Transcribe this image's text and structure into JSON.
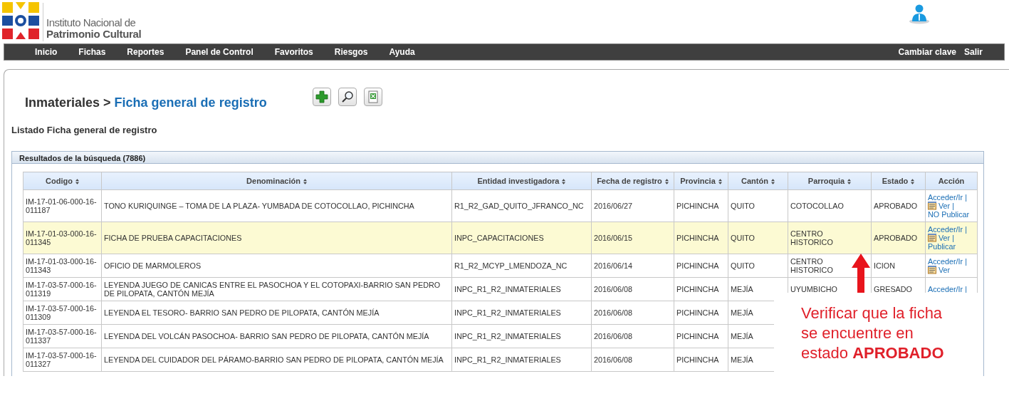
{
  "logo": {
    "line1": "Instituto Nacional de",
    "line2": "Patrimonio Cultural"
  },
  "nav": {
    "items": [
      "Inicio",
      "Fichas",
      "Reportes",
      "Panel de Control",
      "Favoritos",
      "Riesgos",
      "Ayuda"
    ],
    "right": [
      "Cambiar clave",
      "Salir"
    ]
  },
  "breadcrumb": {
    "parent": "Inmateriales",
    "separator": ">",
    "current": "Ficha general de registro"
  },
  "subtitle": "Listado Ficha general de registro",
  "results": {
    "title": "Resultados de la búsqueda (7886)",
    "columns": [
      {
        "label": "Codigo",
        "sortable": true
      },
      {
        "label": "Denominación",
        "sortable": true
      },
      {
        "label": "Entidad investigadora",
        "sortable": true
      },
      {
        "label": "Fecha de registro",
        "sortable": true
      },
      {
        "label": "Provincia",
        "sortable": true
      },
      {
        "label": "Cantón",
        "sortable": true
      },
      {
        "label": "Parroquia",
        "sortable": true
      },
      {
        "label": "Estado",
        "sortable": true
      },
      {
        "label": "Acción",
        "sortable": false
      }
    ],
    "rows": [
      {
        "highlighted": false,
        "cells": [
          "IM-17-01-06-000-16-011187",
          "TONO KURIQUINGE – TOMA DE LA PLAZA- YUMBADA DE COTOCOLLAO, PICHINCHA",
          "R1_R2_GAD_QUITO_JFRANCO_NC",
          "2016/06/27",
          "PICHINCHA",
          "QUITO",
          "COTOCOLLAO",
          "APROBADO"
        ],
        "actions": [
          {
            "text": "Acceder/Ir |",
            "icon": false
          },
          {
            "text": "Ver |",
            "icon": true
          },
          {
            "text": "NO Publicar",
            "icon": false
          }
        ]
      },
      {
        "highlighted": true,
        "cells": [
          "IM-17-01-03-000-16-011345",
          "FICHA DE PRUEBA CAPACITACIONES",
          "INPC_CAPACITACIONES",
          "2016/06/15",
          "PICHINCHA",
          "QUITO",
          "CENTRO HISTORICO",
          "APROBADO"
        ],
        "actions": [
          {
            "text": "Acceder/Ir |",
            "icon": false
          },
          {
            "text": "Ver |",
            "icon": true
          },
          {
            "text": "Publicar",
            "icon": false
          }
        ]
      },
      {
        "highlighted": false,
        "cells": [
          "IM-17-01-03-000-16-011343",
          "OFICIO DE MARMOLEROS",
          "R1_R2_MCYP_LMENDOZA_NC",
          "2016/06/14",
          "PICHINCHA",
          "QUITO",
          "CENTRO HISTORICO",
          "ICION"
        ],
        "actions": [
          {
            "text": "Acceder/Ir |",
            "icon": false
          },
          {
            "text": "Ver",
            "icon": true
          }
        ]
      },
      {
        "highlighted": false,
        "cells": [
          "IM-17-03-57-000-16-011319",
          "LEYENDA JUEGO DE CANICAS ENTRE EL PASOCHOA Y EL COTOPAXI-BARRIO SAN PEDRO DE PILOPATA, CANTÓN MEJÍA",
          "INPC_R1_R2_INMATERIALES",
          "2016/06/08",
          "PICHINCHA",
          "MEJÍA",
          "UYUMBICHO",
          "GRESADO"
        ],
        "actions": [
          {
            "text": "Acceder/Ir |",
            "icon": false
          }
        ]
      },
      {
        "highlighted": false,
        "cells": [
          "IM-17-03-57-000-16-011309",
          "LEYENDA EL TESORO- BARRIO SAN PEDRO DE PILOPATA, CANTÓN MEJÍA",
          "INPC_R1_R2_INMATERIALES",
          "2016/06/08",
          "PICHINCHA",
          "MEJÍA"
        ],
        "actions": []
      },
      {
        "highlighted": false,
        "cells": [
          "IM-17-03-57-000-16-011337",
          "LEYENDA DEL VOLCÁN PASOCHOA- BARRIO SAN PEDRO DE PILOPATA, CANTÓN MEJÍA",
          "INPC_R1_R2_INMATERIALES",
          "2016/06/08",
          "PICHINCHA",
          "MEJÍA"
        ],
        "actions": []
      },
      {
        "highlighted": false,
        "cells": [
          "IM-17-03-57-000-16-011327",
          "LEYENDA DEL CUIDADOR DEL PÁRAMO-BARRIO SAN PEDRO DE PILOPATA, CANTÓN MEJÍA",
          "INPC_R1_R2_INMATERIALES",
          "2016/06/08",
          "PICHINCHA",
          "MEJÍA"
        ],
        "actions": []
      }
    ]
  },
  "callout": {
    "lines": [
      "Verificar que la ficha",
      "se encuentre en",
      "estado **APROBADO**"
    ]
  }
}
